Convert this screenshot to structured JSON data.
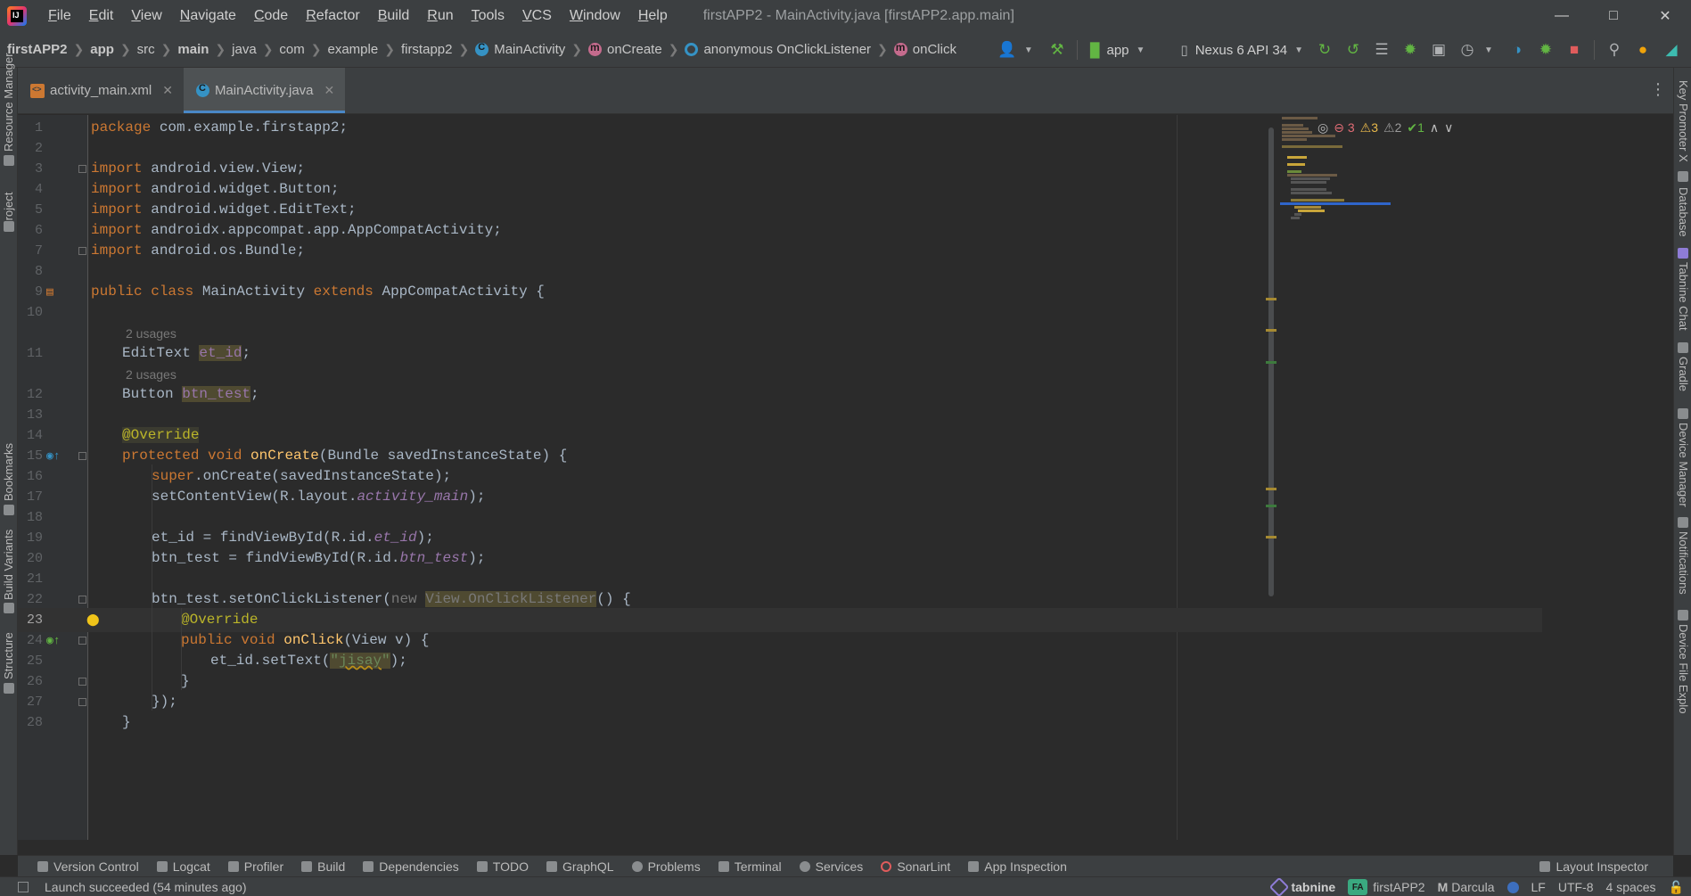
{
  "app": {
    "logo": "IJ",
    "window_title": "firstAPP2 - MainActivity.java [firstAPP2.app.main]",
    "menu": [
      {
        "label": "File",
        "u": "F",
        "rest": "ile"
      },
      {
        "label": "Edit",
        "u": "E",
        "rest": "dit"
      },
      {
        "label": "View",
        "u": "V",
        "rest": "iew"
      },
      {
        "label": "Navigate",
        "u": "N",
        "rest": "avigate"
      },
      {
        "label": "Code",
        "u": "C",
        "rest": "ode"
      },
      {
        "label": "Refactor",
        "u": "R",
        "rest": "efactor"
      },
      {
        "label": "Build",
        "u": "B",
        "rest": "uild"
      },
      {
        "label": "Run",
        "u": "R",
        "rest": "un"
      },
      {
        "label": "Tools",
        "u": "T",
        "rest": "ools"
      },
      {
        "label": "VCS",
        "u": "V",
        "rest": "CS"
      },
      {
        "label": "Window",
        "u": "W",
        "rest": "indow"
      },
      {
        "label": "Help",
        "u": "H",
        "rest": "elp"
      }
    ]
  },
  "breadcrumb": {
    "project": "firstAPP2",
    "module": "app",
    "src": "src",
    "main": "main",
    "java": "java",
    "com": "com",
    "example": "example",
    "pkg": "firstapp2",
    "cls": "MainActivity",
    "method": "onCreate",
    "anon": "anonymous OnClickListener",
    "click": "onClick"
  },
  "toolbar": {
    "run_config": "app",
    "device": "Nexus 6 API 34"
  },
  "tabs": [
    {
      "label": "activity_main.xml",
      "active": false
    },
    {
      "label": "MainActivity.java",
      "active": true
    }
  ],
  "inspection": {
    "errors": "3",
    "warnings": "3",
    "weak_warnings": "2",
    "typos": "1"
  },
  "code": {
    "hint_usages": "2 usages",
    "l1_kw": "package",
    "l1_rest": " com.example.firstapp2;",
    "l3_kw": "import",
    "l3_rest": " android.view.View;",
    "l4_kw": "import",
    "l4_rest": " android.widget.Button;",
    "l5_kw": "import",
    "l5_rest": " android.widget.EditText;",
    "l6_kw": "import",
    "l6_rest": " androidx.appcompat.app.AppCompatActivity;",
    "l7_kw": "import",
    "l7_rest": " android.os.Bundle;",
    "l9_kw1": "public class",
    "l9_cls": " MainActivity ",
    "l9_kw2": "extends",
    "l9_rest": " AppCompatActivity {",
    "l11_type": "EditText ",
    "l11_field": "et_id",
    "l11_end": ";",
    "l12_type": "Button ",
    "l12_field": "btn_test",
    "l12_end": ";",
    "l14_ann": "@Override",
    "l15_kw": "protected void ",
    "l15_fn": "onCreate",
    "l15_rest": "(Bundle savedInstanceState) {",
    "l16_kw": "super",
    "l16_rest": ".onCreate(savedInstanceState);",
    "l17_pre": "setContentView(R.layout.",
    "l17_f": "activity_main",
    "l17_end": ");",
    "l19_pre": "et_id = findViewById(R.id.",
    "l19_f": "et_id",
    "l19_end": ");",
    "l20_pre": "btn_test = findViewById(R.id.",
    "l20_f": "btn_test",
    "l20_end": ");",
    "l22_pre": "btn_test.setOnClickListener(",
    "l22_kw": "new ",
    "l22_hl": "View.OnClickListener",
    "l22_end": "() {",
    "l23_ann": "@Override",
    "l24_kw": "public void ",
    "l24_fn": "onClick",
    "l24_rest": "(View v) {",
    "l25_pre": "et_id.setText(",
    "l25_q1": "\"",
    "l25_str": "jisay",
    "l25_q2": "\"",
    "l25_end": ");",
    "l26": "}",
    "l27": "});",
    "l28": "}"
  },
  "left_tools": [
    "Resource Manager",
    "Project",
    "Bookmarks",
    "Build Variants",
    "Structure"
  ],
  "right_tools": [
    "Key Promoter X",
    "Database",
    "Tabnine Chat",
    "Gradle",
    "Device Manager",
    "Notifications",
    "Device File Explo"
  ],
  "bottom_tools": [
    "Version Control",
    "Logcat",
    "Profiler",
    "Build",
    "Dependencies",
    "TODO",
    "GraphQL",
    "Problems",
    "Terminal",
    "Services",
    "SonarLint",
    "App Inspection"
  ],
  "layout_inspector": "Layout Inspector",
  "status": {
    "message": "Launch succeeded (54 minutes ago)",
    "tabnine": "tabnine",
    "project_badge": "FA",
    "project": "firstAPP2",
    "theme_icon": "M",
    "theme": "Darcula",
    "line_sep": "LF",
    "encoding": "UTF-8",
    "indent": "4 spaces"
  }
}
